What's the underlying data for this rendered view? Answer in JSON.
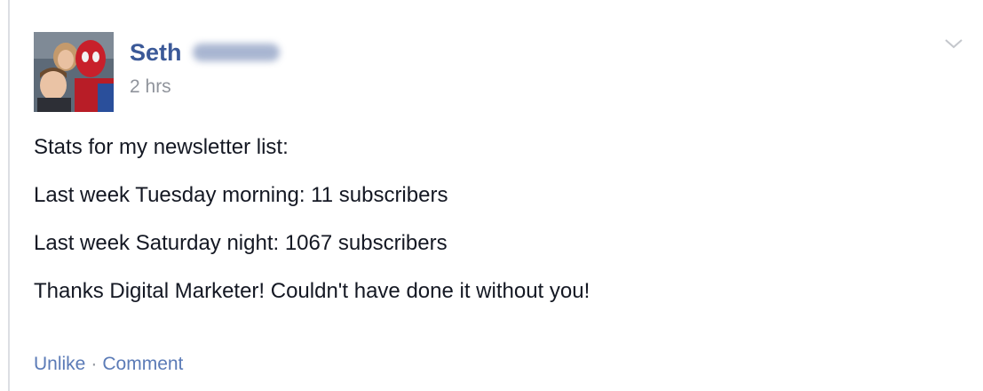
{
  "post": {
    "author_first_name": "Seth",
    "author_last_name_redacted": true,
    "timestamp": "2 hrs",
    "lines": [
      "Stats for my newsletter list:",
      "Last week Tuesday morning: 11 subscribers",
      "Last week Saturday night: 1067 subscribers",
      "Thanks Digital Marketer! Couldn't have done it without you!"
    ],
    "actions": {
      "unlike": "Unlike",
      "separator": "·",
      "comment": "Comment"
    },
    "menu_icon": "chevron-down-icon"
  },
  "colors": {
    "author_link": "#3b5998",
    "action_link": "#5b7bb7",
    "meta_gray": "#90949c",
    "body_text": "#141823"
  }
}
